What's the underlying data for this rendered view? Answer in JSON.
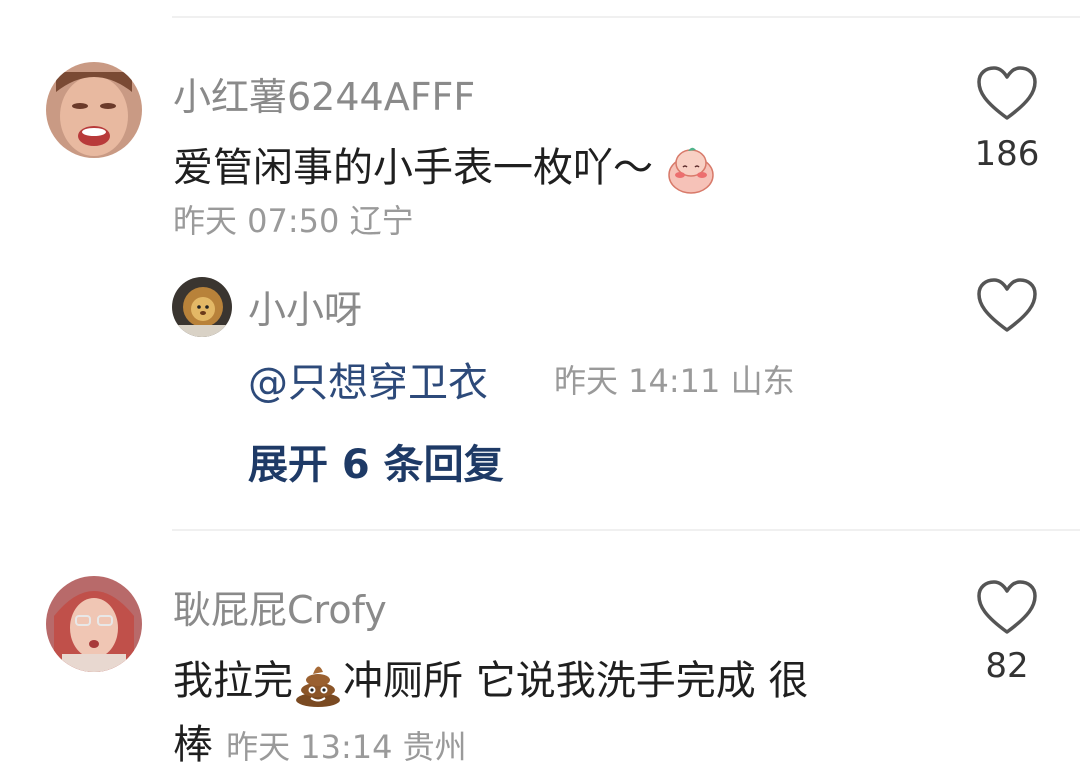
{
  "comments": [
    {
      "username": "小红薯6244AFFF",
      "text": "爱管闲事的小手表一枚吖～",
      "sticker": "blushing-peach-emoji",
      "meta": "昨天 07:50 辽宁",
      "likes": "186",
      "avatar": "crying-woman-avatar"
    },
    {
      "username": "耿屁屁Crofy",
      "text_before": "我拉完",
      "sticker": "poop-emoji",
      "text_after": "冲厕所 它说我洗手完成 很",
      "text_line2": "棒",
      "meta": "昨天 13:14 贵州",
      "likes": "82",
      "avatar": "surprised-girl-avatar"
    }
  ],
  "reply": {
    "username": "小小呀",
    "mention": "@只想穿卫衣",
    "meta": "昨天 14:11 山东",
    "avatar": "lion-plush-avatar"
  },
  "expand_label": "展开 6 条回复",
  "colors": {
    "username": "#8a8a8a",
    "text": "#1f1f1f",
    "meta": "#9a9a9a",
    "link": "#1e3a66",
    "divider": "#f0f0f0"
  }
}
